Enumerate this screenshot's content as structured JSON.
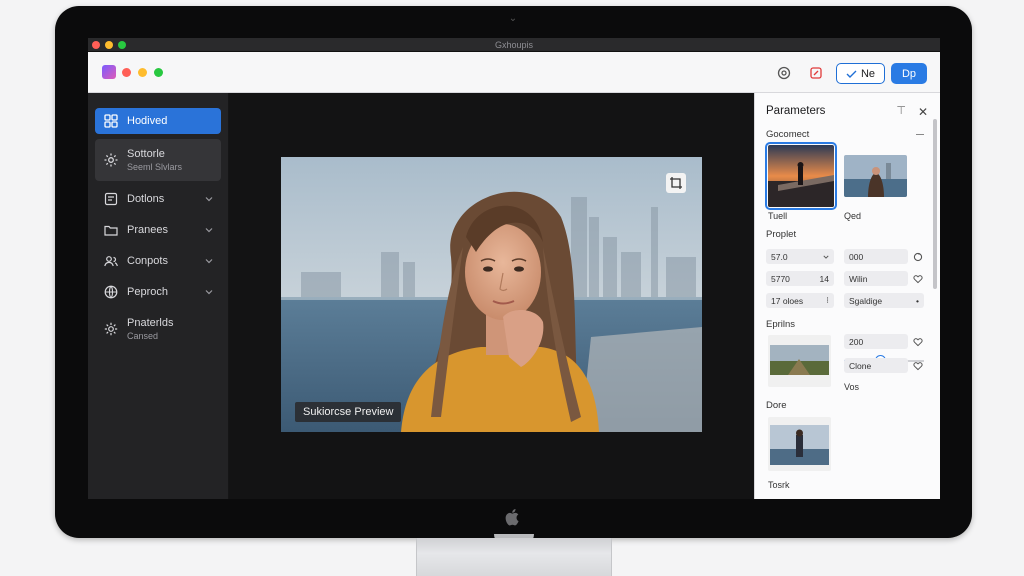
{
  "window": {
    "title": "Gxhoupis"
  },
  "toolbar": {
    "ghost_button_label": "Ne",
    "primary_button_label": "Dp"
  },
  "colors": {
    "accent": "#2a7be4",
    "dot_red": "#ff5f57",
    "dot_yellow": "#febc2e",
    "dot_green": "#28c840"
  },
  "sidebar": {
    "items": [
      {
        "label": "Hodived",
        "icon": "grid-icon",
        "state": "active"
      },
      {
        "label": "Sottorle",
        "sub": "Seeml Slvlars",
        "icon": "gear-icon",
        "state": "selected"
      },
      {
        "label": "Dotlons",
        "icon": "layers-icon",
        "state": "collapsed"
      },
      {
        "label": "Pranees",
        "icon": "folder-icon",
        "state": "collapsed"
      },
      {
        "label": "Conpots",
        "icon": "users-icon",
        "state": "collapsed"
      },
      {
        "label": "Peproch",
        "icon": "globe-icon",
        "state": "collapsed"
      },
      {
        "label": "Pnaterlds",
        "sub": "Cansed",
        "icon": "cog-icon",
        "state": "static"
      }
    ]
  },
  "canvas": {
    "preview_badge": "Sukiorcse Preview"
  },
  "panel": {
    "title": "Parameters",
    "sections": {
      "first": "Gocomect",
      "second": "Proplet",
      "third": "Eprilns",
      "fourth": "Dore"
    },
    "thumbs": {
      "a_caption": "Tuell",
      "b_caption": "Qed",
      "d_caption": "Tosrk"
    },
    "fields": {
      "row1_left": "57.0",
      "row1_right": "000",
      "row2_left": "5770",
      "row2_left_suffix": "14",
      "row2_right": "Wilin",
      "row3_left": "17 oloes",
      "row3_right": "Sgaldige",
      "row4_right": "200",
      "row5_right": "Clone",
      "row6_right": "Vos"
    },
    "slider_value": 0.45
  }
}
